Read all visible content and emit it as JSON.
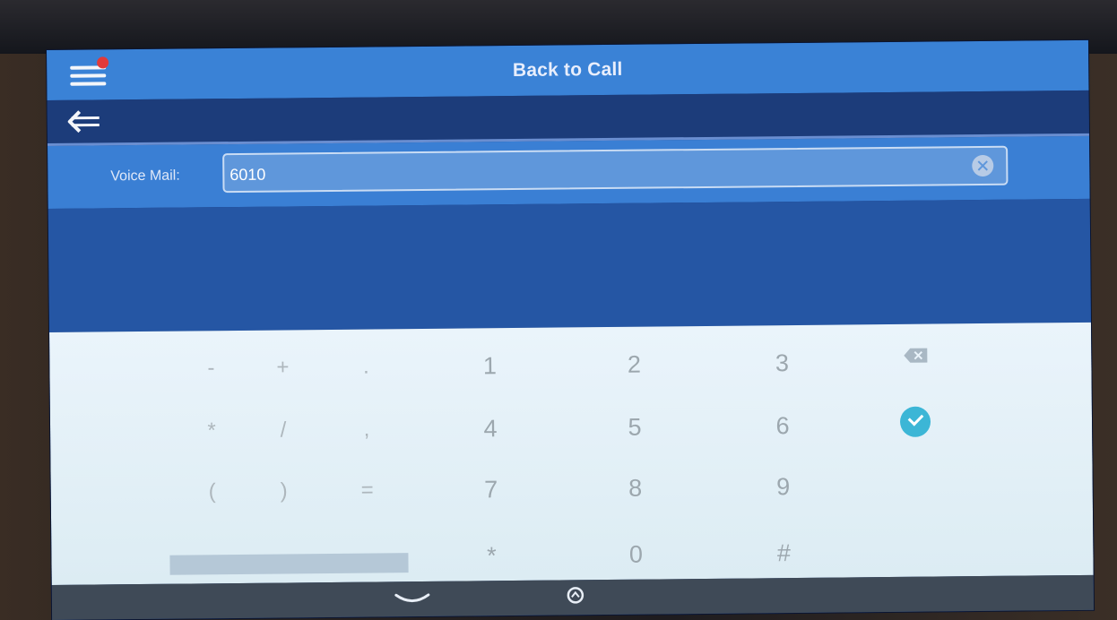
{
  "header": {
    "title": "Back to Call"
  },
  "field": {
    "label": "Voice Mail:",
    "value": "6010"
  },
  "keypad": {
    "symbols_row1": [
      "-",
      "+",
      "."
    ],
    "symbols_row2": [
      "*",
      "/",
      ","
    ],
    "symbols_row3": [
      "(",
      ")",
      "="
    ],
    "digits_row1": [
      "1",
      "2",
      "3"
    ],
    "digits_row2": [
      "4",
      "5",
      "6"
    ],
    "digits_row3": [
      "7",
      "8",
      "9"
    ],
    "digits_row4": [
      "*",
      "0",
      "#"
    ]
  },
  "icons": {
    "menu": "hamburger-menu-icon",
    "notification": "red-dot-badge",
    "back": "left-arrow-icon",
    "clear": "clear-circle-icon",
    "backspace": "backspace-icon",
    "confirm": "check-circle-icon",
    "collapse": "chevron-down-icon",
    "home": "home-icon"
  },
  "colors": {
    "header": "#3a82d6",
    "accent_confirm": "#3cb6d6",
    "notification": "#e23a3a"
  }
}
